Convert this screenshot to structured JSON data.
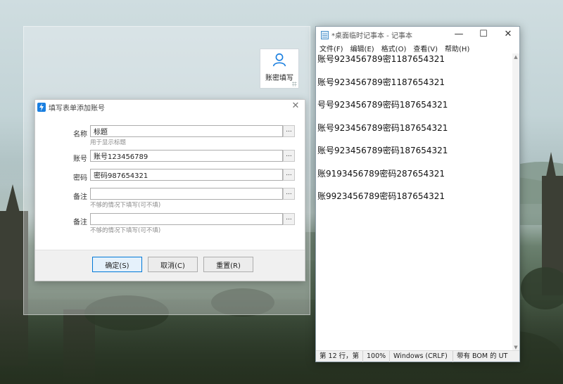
{
  "floating_button": {
    "label": "账密填写",
    "icon": "user-icon"
  },
  "dialog": {
    "title": "填写表单添加账号",
    "fields": [
      {
        "label": "名称",
        "value": "标题",
        "hint": "用于显示标题"
      },
      {
        "label": "账号",
        "value": "账号123456789",
        "hint": ""
      },
      {
        "label": "密码",
        "value": "密码987654321",
        "hint": ""
      },
      {
        "label": "备注",
        "value": "",
        "hint": "不够的情况下填写(可不填)"
      },
      {
        "label": "备注",
        "value": "",
        "hint": "不够的情况下填写(可不填)"
      }
    ],
    "dots_label": "...",
    "buttons": {
      "ok": "确定(S)",
      "cancel": "取消(C)",
      "reset": "重置(R)"
    }
  },
  "notepad": {
    "title": "*桌面临时记事本 - 记事本",
    "menus": [
      "文件(F)",
      "编辑(E)",
      "格式(O)",
      "查看(V)",
      "帮助(H)"
    ],
    "lines": [
      "账号923456789密1187654321",
      "账号923456789密1187654321",
      "号号923456789密码187654321",
      "账号923456789密码187654321",
      "账号923456789密码187654321",
      "账9193456789密码287654321",
      "账9923456789密码187654321"
    ],
    "status": {
      "position": "第 12 行，第",
      "zoom": "100%",
      "line_ending": "Windows (CRLF)",
      "encoding": "带有 BOM 的 UT"
    }
  },
  "colors": {
    "primary_button_border": "#0078d7",
    "dialog_icon": "#1a7fe0"
  }
}
